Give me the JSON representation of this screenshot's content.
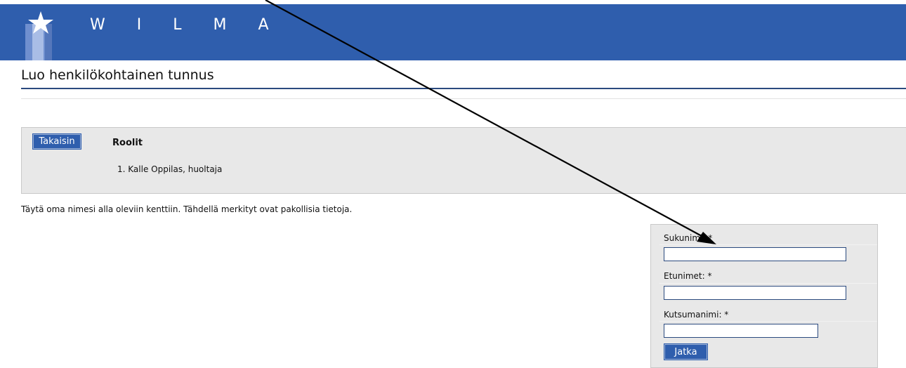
{
  "header": {
    "brand": "W I L M A",
    "logo_icon": "star-logo-icon",
    "background_color": "#2f5ead"
  },
  "page": {
    "title": "Luo henkilökohtainen tunnus"
  },
  "roles": {
    "back_button_label": "Takaisin",
    "heading": "Roolit",
    "items": [
      "1. Kalle Oppilas, huoltaja"
    ]
  },
  "instructions": "Täytä oma nimesi alla oleviin kenttiin. Tähdellä merkityt ovat pakollisia tietoja.",
  "form": {
    "surname_label": "Sukunimi: *",
    "surname_value": "",
    "firstnames_label": "Etunimet: *",
    "firstnames_value": "",
    "nickname_label": "Kutsumanimi: *",
    "nickname_value": "",
    "continue_label": "Jatka"
  },
  "annotation": {
    "arrow_icon": "annotation-arrow-icon",
    "arrow_color": "#000000"
  }
}
